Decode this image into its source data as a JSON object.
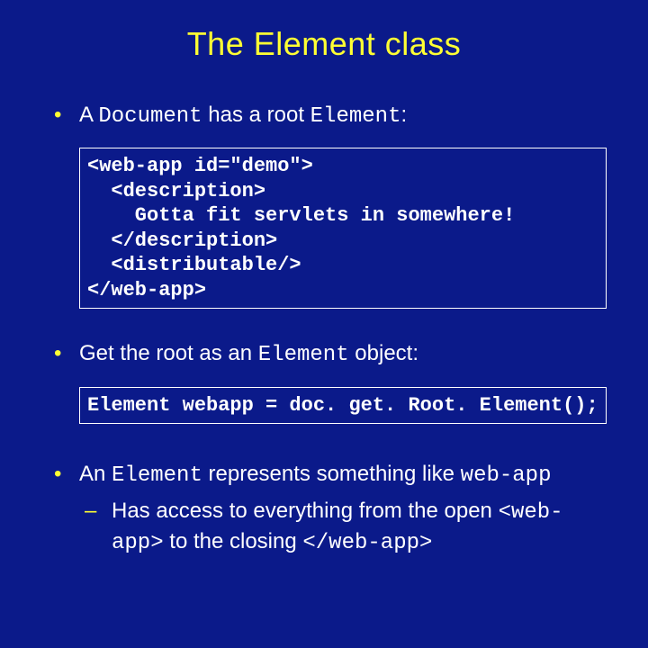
{
  "title": "The Element class",
  "bullet1": {
    "pre": "A ",
    "code1": "Document",
    "mid": " has a root ",
    "code2": "Element",
    "post": ":"
  },
  "codebox1": "<web-app id=\"demo\">\n  <description>\n    Gotta fit servlets in somewhere!\n  </description>\n  <distributable/>\n</web-app>",
  "bullet2": {
    "pre": "Get the root as an ",
    "code1": "Element",
    "post": " object:"
  },
  "codebox2": "Element webapp = doc. get. Root. Element();",
  "bullet3": {
    "pre": "An ",
    "code1": "Element",
    "mid": " represents something like ",
    "code2": "web-app"
  },
  "sub1": {
    "pre": "Has access to everything from the open ",
    "code1": "<web-app>",
    "mid": " to the closing ",
    "code2": "</web-app>"
  }
}
